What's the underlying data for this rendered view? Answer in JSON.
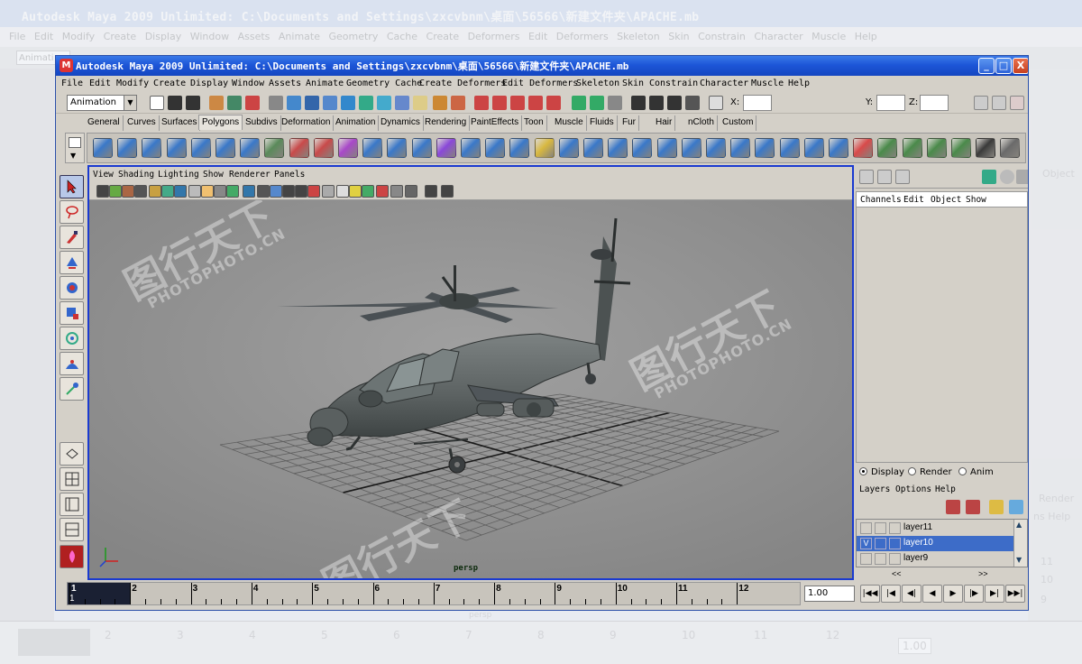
{
  "window": {
    "title": "Autodesk Maya 2009 Unlimited: C:\\Documents and Settings\\zxcvbnm\\桌面\\56566\\新建文件夹\\APACHE.mb",
    "icon": "maya-icon",
    "buttons": {
      "minimize": "_",
      "maximize": "□",
      "close": "X"
    }
  },
  "menu": [
    "File",
    "Edit",
    "Modify",
    "Create",
    "Display",
    "Window",
    "Assets",
    "Animate",
    "Geometry Cache",
    "Create Deformers",
    "Edit Deformers",
    "Skeleton",
    "Skin",
    "Constrain",
    "Character",
    "Muscle",
    "Help"
  ],
  "statusline": {
    "mode": "Animation",
    "x_label": "X:",
    "y_label": "Y:",
    "z_label": "Z:",
    "x_value": "",
    "y_value": "",
    "z_value": ""
  },
  "shelf": {
    "tabs": [
      "General",
      "Curves",
      "Surfaces",
      "Polygons",
      "Subdivs",
      "Deformation",
      "Animation",
      "Dynamics",
      "Rendering",
      "PaintEffects",
      "Toon",
      "Muscle",
      "Fluids",
      "Fur",
      "Hair",
      "nCloth",
      "Custom"
    ],
    "active_tab": "Polygons",
    "icon_colors": [
      "#3a78c8",
      "#3a78c8",
      "#3a78c8",
      "#3a78c8",
      "#3a78c8",
      "#3a78c8",
      "#3a78c8",
      "#5a8a5a",
      "#c84a4a",
      "#c84a4a",
      "#a848c8",
      "#3a78c8",
      "#3a78c8",
      "#3a78c8",
      "#8a48d8",
      "#3a78c8",
      "#3a78c8",
      "#3a78c8",
      "#d8b840",
      "#3a78c8",
      "#3a78c8",
      "#3a78c8",
      "#3a78c8",
      "#3a78c8",
      "#3a78c8",
      "#3a78c8",
      "#3a78c8",
      "#3a78c8",
      "#3a78c8",
      "#3a78c8",
      "#3a78c8",
      "#d84a4a",
      "#4a8a4a",
      "#4a8a4a",
      "#4a8a4a",
      "#4a8a4a",
      "#3a3a3a",
      "#6a6a6a"
    ]
  },
  "panel": {
    "menu": [
      "View",
      "Shading",
      "Lighting",
      "Show",
      "Renderer",
      "Panels"
    ],
    "camera": "persp"
  },
  "channelbox": {
    "menu": [
      "Channels",
      "Edit",
      "Object",
      "Show"
    ]
  },
  "layers": {
    "radio_display": "Display",
    "radio_render": "Render",
    "radio_anim": "Anim",
    "menu": [
      "Layers",
      "Options",
      "Help"
    ],
    "rows": [
      {
        "name": "layer11",
        "visible": "",
        "selected": false
      },
      {
        "name": "layer10",
        "visible": "V",
        "selected": true
      },
      {
        "name": "layer9",
        "visible": "",
        "selected": false
      }
    ],
    "prev": "<<",
    "next": ">>"
  },
  "timeline": {
    "labels": [
      "1",
      "2",
      "3",
      "4",
      "5",
      "6",
      "7",
      "8",
      "9",
      "10",
      "11",
      "12"
    ],
    "current_frame_marker": "1",
    "current_frame": "1.00"
  },
  "watermark": {
    "text_cn": "图行天下",
    "text_en": "PHOTOPHOTO.CN"
  },
  "background": {
    "title": "Autodesk Maya 2009 Unlimited: C:\\Documents and Settings\\zxcvbnm\\桌面\\56566\\新建文件夹\\APACHE.mb",
    "menu": "File  Edit  Modify  Create  Display  Window  Assets  Animate  Geometry Cache  Create Deformers  Edit Deformers  Skeleton  Skin  Constrain  Character  Muscle  Help",
    "mode": "Animati",
    "right_labels": [
      "Object",
      "Render",
      "ns Help",
      "11",
      "10",
      "9"
    ],
    "timeline_labels": [
      "2",
      "3",
      "4",
      "5",
      "6",
      "7",
      "8",
      "9",
      "10",
      "11",
      "12"
    ],
    "frame": "1.00",
    "camera": "persp"
  }
}
